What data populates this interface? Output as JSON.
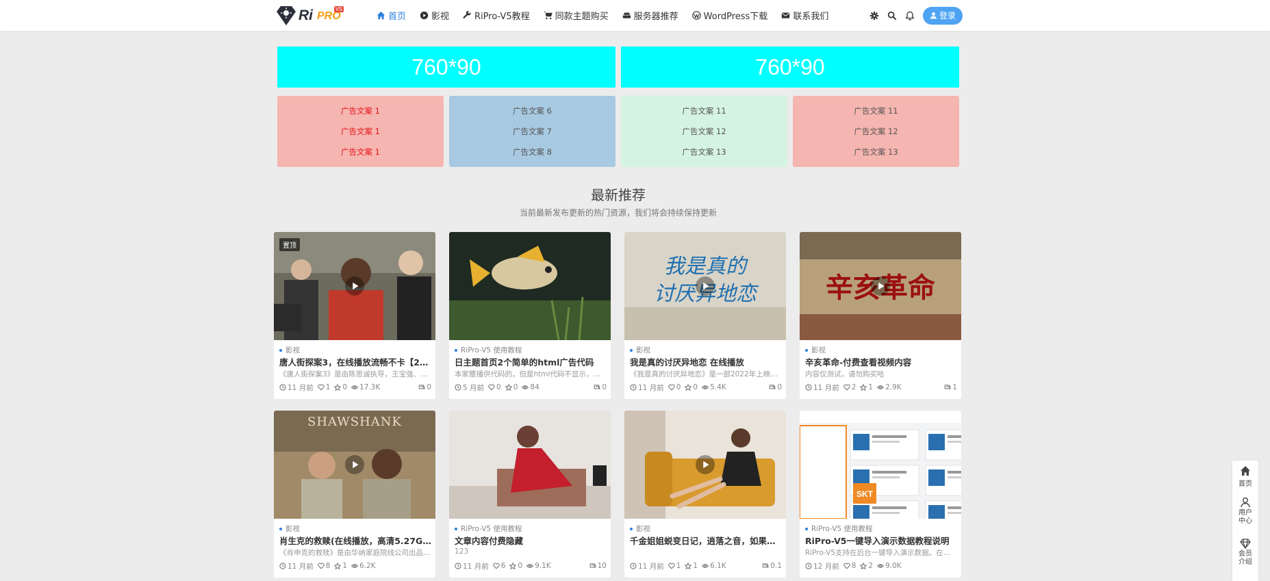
{
  "header": {
    "logo_text": "Ri",
    "logo_pro": "PRO",
    "logo_ver": "V5",
    "nav": [
      {
        "label": "首页",
        "icon": "home-icon",
        "active": true
      },
      {
        "label": "影视",
        "icon": "play-circle-icon"
      },
      {
        "label": "RiPro-V5教程",
        "icon": "wrench-icon"
      },
      {
        "label": "同款主题购买",
        "icon": "cart-icon"
      },
      {
        "label": "服务器推荐",
        "icon": "server-icon"
      },
      {
        "label": "WordPress下载",
        "icon": "wordpress-icon"
      },
      {
        "label": "联系我们",
        "icon": "envelope-icon"
      }
    ],
    "login_label": "登录"
  },
  "banners": [
    "760*90",
    "760*90"
  ],
  "ad_boxes": [
    {
      "bg": "#f5b5b0",
      "color": "#e8141a",
      "lines": [
        "广告文案 1",
        "广告文案 1",
        "广告文案 1"
      ]
    },
    {
      "bg": "#a8c9e2",
      "color": "#555555",
      "lines": [
        "广告文案 6",
        "广告文案 7",
        "广告文案 8"
      ]
    },
    {
      "bg": "#d5f3e2",
      "color": "#555555",
      "lines": [
        "广告文案 11",
        "广告文案 12",
        "广告文案 13"
      ]
    },
    {
      "bg": "#f5b5b0",
      "color": "#555555",
      "lines": [
        "广告文案 11",
        "广告文案 12",
        "广告文案 13"
      ]
    }
  ],
  "section": {
    "title": "最新推荐",
    "subtitle": "当前最新发布更新的热门资源，我们将会持续保持更新"
  },
  "cards": [
    {
      "category": "影视",
      "title": "唐人街探案3，在线播放流畅不卡【2.5…",
      "excerpt": "《唐人街探案3》是由陈思诚执导，王宝强、刘昊…",
      "time": "11 月前",
      "likes": "1",
      "favs": "0",
      "views": "17.3K",
      "comments": "0",
      "badge": "置顶",
      "play": true,
      "art": "crowd"
    },
    {
      "category": "RiPro-V5 使用教程",
      "title": "日主题首页2个简单的html广告代码",
      "excerpt": "本家腰播供代码的，但是html代码不显示，所以…",
      "time": "5 月前",
      "likes": "0",
      "favs": "0",
      "views": "84",
      "comments": "0",
      "play": false,
      "art": "fish"
    },
    {
      "category": "影视",
      "title": "我是真的讨厌异地恋 在线播放",
      "excerpt": "《我是真的讨厌异地恋》是一部2022年上映的中…",
      "time": "11 月前",
      "likes": "0",
      "favs": "0",
      "views": "5.4K",
      "comments": "0",
      "play": true,
      "art": "poster",
      "art_text": "我是真的讨厌异地恋"
    },
    {
      "category": "影视",
      "title": "辛亥革命-付费查看视频内容",
      "excerpt": "内容仅测试，请勿购买哈",
      "time": "11 月前",
      "likes": "2",
      "favs": "1",
      "views": "2.9K",
      "comments": "1",
      "play": true,
      "art": "revolution",
      "art_text": "辛亥革命"
    },
    {
      "category": "影视",
      "title": "肖生克的救赎(在线播放，高清5.27GB)",
      "excerpt": "《肖申克的救赎》是由华纳家庭院线公司出品，弗…",
      "time": "11 月前",
      "likes": "8",
      "favs": "1",
      "views": "6.2K",
      "comments": "",
      "play": true,
      "art": "shawshank",
      "art_text": "SHAWSHANK"
    },
    {
      "category": "RiPro-V5 使用教程",
      "title": "文章内容付费隐藏",
      "excerpt": "123",
      "time": "11 月前",
      "likes": "6",
      "favs": "0",
      "views": "9.1K",
      "comments": "10",
      "play": false,
      "art": "red-dress"
    },
    {
      "category": "影视",
      "title": "千金姐姐蜕变日记，逍落之音，如果家…",
      "excerpt": "",
      "time": "11 月前",
      "likes": "1",
      "favs": "1",
      "views": "6.1K",
      "comments": "0.1",
      "play": true,
      "art": "sofa"
    },
    {
      "category": "RiPro-V5 使用教程",
      "title": "RiPro-V5一键导入演示数据教程说明",
      "excerpt": "RiPro-V5支持在后台一键导入演示数据。在你WP…",
      "time": "12 月前",
      "likes": "8",
      "favs": "2",
      "views": "9.0K",
      "comments": "",
      "play": false,
      "art": "screenshot",
      "art_text": "SKT"
    }
  ],
  "sidebar": [
    {
      "label": "首页",
      "icon": "home-icon"
    },
    {
      "label": "用户中心",
      "icon": "user-icon"
    },
    {
      "label": "会员介绍",
      "icon": "diamond-icon"
    }
  ]
}
